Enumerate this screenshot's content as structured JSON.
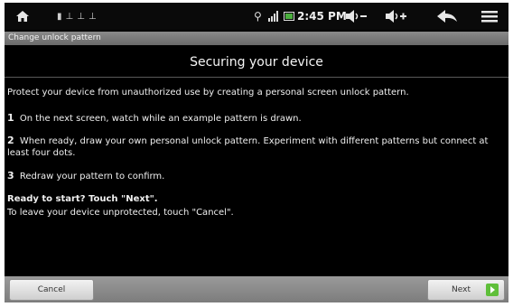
{
  "status_bar": {
    "time": "2:45 PM",
    "icons": {
      "home": "home-icon",
      "notifications": "notification-icons",
      "usb": "usb-icon",
      "signal": "signal-icon",
      "battery": "battery-icon",
      "volume_down": "volume-down-icon",
      "volume_up": "volume-up-icon",
      "back": "back-arrow-icon",
      "menu": "menu-icon"
    },
    "colors": {
      "battery": "#4caf3f"
    }
  },
  "title_bar": {
    "title": "Change unlock pattern"
  },
  "content": {
    "heading": "Securing your device",
    "intro": "Protect your device from unauthorized use by creating a personal screen unlock pattern.",
    "steps": [
      {
        "num": "1",
        "text": "On the next screen, watch while an example pattern is drawn."
      },
      {
        "num": "2",
        "text": "When ready, draw your own personal unlock pattern. Experiment with different patterns but connect at least four dots."
      },
      {
        "num": "3",
        "text": "Redraw your pattern to confirm."
      }
    ],
    "ready": "Ready to start? Touch \"Next\".",
    "leave": "To leave your device unprotected, touch \"Cancel\"."
  },
  "buttons": {
    "cancel": "Cancel",
    "next": "Next"
  },
  "colors": {
    "next_accent": "#5fbf3a"
  }
}
